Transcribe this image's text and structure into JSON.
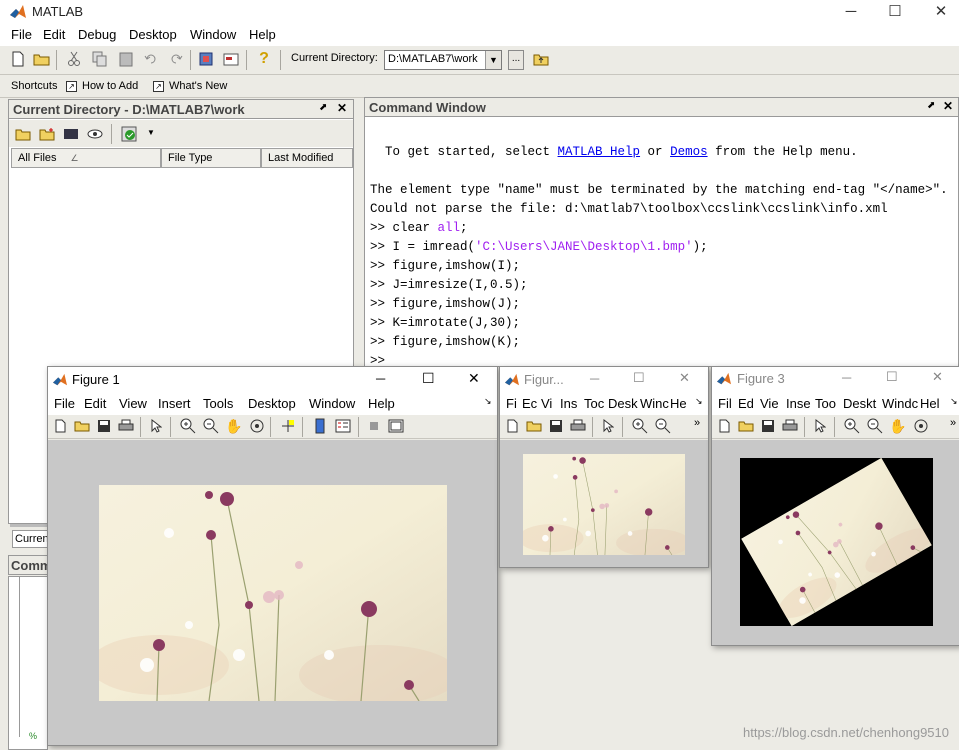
{
  "app": {
    "title": "MATLAB"
  },
  "menu": [
    "File",
    "Edit",
    "Debug",
    "Desktop",
    "Window",
    "Help"
  ],
  "toolbar": {
    "current_directory_label": "Current Directory:",
    "current_directory_value": "D:\\MATLAB7\\work",
    "browse_label": "..."
  },
  "shortcuts": {
    "label": "Shortcuts",
    "how_to_add": "How to Add",
    "whats_new": "What's New"
  },
  "current_directory_panel": {
    "title": "Current Directory - D:\\MATLAB7\\work",
    "columns": [
      "All Files",
      "File Type",
      "Last Modified"
    ],
    "tab_label": "Curren"
  },
  "command_history_panel": {
    "title": "Comm"
  },
  "command_window": {
    "title": "Command Window",
    "intro_prefix": "  To get started, select ",
    "link_help": "MATLAB Help",
    "intro_or": " or ",
    "link_demos": "Demos",
    "intro_suffix": " from the Help menu.",
    "line_err1": "The element type \"name\" must be terminated by the matching end-tag \"</name>\".",
    "line_err2": "Could not parse the file: d:\\matlab7\\toolbox\\ccslink\\ccslink\\info.xml",
    "cmd1_a": ">> clear ",
    "cmd1_b": "all",
    "cmd1_c": ";",
    "cmd2_a": ">> I = imread(",
    "cmd2_b": "'C:\\Users\\JANE\\Desktop\\1.bmp'",
    "cmd2_c": ");",
    "cmd3": ">> figure,imshow(I);",
    "cmd4": ">> J=imresize(I,0.5);",
    "cmd5": ">> figure,imshow(J);",
    "cmd6": ">> K=imrotate(J,30);",
    "cmd7": ">> figure,imshow(K);",
    "cmd8": ">>"
  },
  "figure1": {
    "title": "Figure 1",
    "menu": [
      "File",
      "Edit",
      "View",
      "Insert",
      "Tools",
      "Desktop",
      "Window",
      "Help"
    ]
  },
  "figure2": {
    "title": "Figur...",
    "menu": [
      "Fi",
      "Ec",
      "Vi",
      "Ins",
      "Toc",
      "Desk",
      "Winc",
      "He"
    ]
  },
  "figure3": {
    "title": "Figure 3",
    "menu": [
      "Fil",
      "Ed",
      "Vie",
      "Inse",
      "Too",
      "Deskt",
      "Windc",
      "Hel"
    ]
  },
  "watermark": "https://blog.csdn.net/chenhong9510",
  "colors": {
    "link": "#0000ee",
    "string": "#a020f0",
    "canvas": "#c8c8c8"
  }
}
